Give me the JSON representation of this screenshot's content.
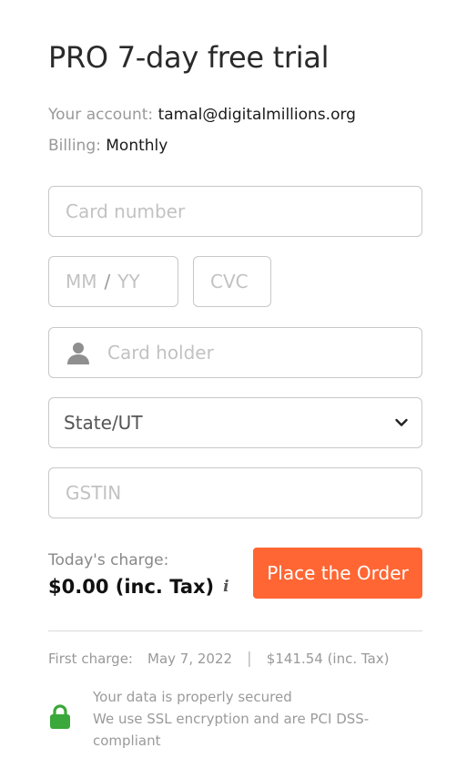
{
  "title": "PRO 7-day free trial",
  "account": {
    "label": "Your account:",
    "value": "tamal@digitalmillions.org"
  },
  "billing": {
    "label": "Billing:",
    "value": "Monthly"
  },
  "form": {
    "card_number_placeholder": "Card number",
    "expiry_month_placeholder": "MM",
    "expiry_separator": "/",
    "expiry_year_placeholder": "YY",
    "cvc_placeholder": "CVC",
    "card_holder_placeholder": "Card holder",
    "state_selected": "State/UT",
    "gstin_placeholder": "GSTIN"
  },
  "charge": {
    "label": "Today's charge:",
    "amount": "$0.00 (inc. Tax)",
    "info_icon": "i"
  },
  "order_button": "Place the Order",
  "first_charge": {
    "label": "First charge:",
    "date": "May 7, 2022",
    "separator": "|",
    "amount": "$141.54 (inc. Tax)"
  },
  "security": {
    "line1": "Your data is properly secured",
    "line2": "We use SSL encryption and are PCI DSS-compliant"
  },
  "colors": {
    "accent": "#ff6633",
    "lock": "#3aa83a",
    "border": "#c8c8c8"
  },
  "icons": {
    "card_holder": "user-icon",
    "state": "chevron-down-icon",
    "charge_info": "info-icon",
    "security": "lock-icon"
  }
}
